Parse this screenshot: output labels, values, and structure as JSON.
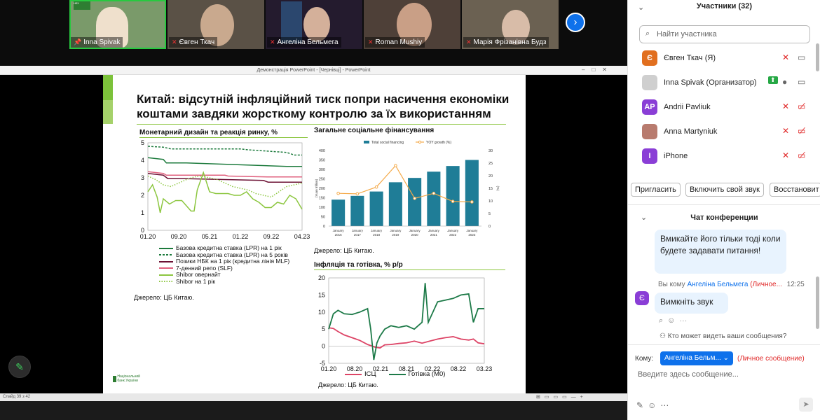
{
  "video_strip": {
    "tiles": [
      {
        "name": "Inna Spivak",
        "mic": "pin",
        "bg": "#7a9a6a"
      },
      {
        "name": "Євген Ткач",
        "mic": "muted",
        "bg": "#5a5146"
      },
      {
        "name": "Ангеліна Бельмега",
        "mic": "muted",
        "bg": "#241b2e"
      },
      {
        "name": "Roman Mushiy",
        "mic": "muted",
        "bg": "#4e4038"
      },
      {
        "name": "Марія Фрізанівна Будз",
        "mic": "muted",
        "bg": "#6b6152"
      }
    ],
    "next_glyph": "›"
  },
  "ppt": {
    "window_title": "Демонстрація PowerPoint - [Чернівці] - PowerPoint",
    "status_text": "Слайд 39 з 42"
  },
  "slide": {
    "title": "Китай: відсутній інфляційний тиск попри насичення економіки коштами завдяки жорсткому контролю за їх використанням",
    "nbu_logo": "Національний банк України",
    "chart1": {
      "title": "Монетарний дизайн та реакція ринку, %",
      "source": "Джерело: ЦБ Китаю."
    },
    "chart2": {
      "title": "Загальне соціальне фінансування",
      "source": "Джерело: ЦБ Китаю."
    },
    "chart3": {
      "title": "Інфляція та готівка, % р/р",
      "source": "Джерело: ЦБ Китаю."
    }
  },
  "chart_data": [
    {
      "type": "line",
      "title": "Монетарний дизайн та реакція ринку, %",
      "xlabels": [
        "01.20",
        "09.20",
        "05.21",
        "01.22",
        "09.22",
        "04.23"
      ],
      "ylim": [
        0,
        5
      ],
      "yticks": [
        0,
        1,
        2,
        3,
        4,
        5
      ],
      "series": [
        {
          "name": "Базова кредитна ставка (LPR) на 1 рік",
          "color": "#1c7a3c",
          "style": "solid",
          "x": [
            0,
            0.1,
            0.12,
            0.22,
            0.25,
            0.9,
            0.95,
            1
          ],
          "values": [
            4.15,
            4.05,
            3.85,
            3.85,
            3.85,
            3.65,
            3.65,
            3.65
          ]
        },
        {
          "name": "Базова кредитна ставка (LPR) на 5 років",
          "color": "#1c7a3c",
          "style": "dashed",
          "x": [
            0,
            0.1,
            0.15,
            0.6,
            0.65,
            0.9,
            0.95,
            1
          ],
          "values": [
            4.8,
            4.75,
            4.65,
            4.65,
            4.6,
            4.45,
            4.3,
            4.3
          ]
        },
        {
          "name": "Позики НБК на 1 рік (кредитна лінія MLF)",
          "color": "#6b1033",
          "style": "solid",
          "x": [
            0,
            0.1,
            0.13,
            0.22,
            0.25,
            0.75,
            0.78,
            0.85,
            1
          ],
          "values": [
            3.25,
            3.15,
            2.95,
            2.95,
            2.95,
            2.85,
            2.75,
            2.75,
            2.75
          ]
        },
        {
          "name": "7-денний репо (SLF)",
          "color": "#e0607e",
          "style": "solid",
          "x": [
            0,
            0.1,
            0.12,
            0.5,
            0.52,
            0.78,
            1
          ],
          "values": [
            3.35,
            3.25,
            3.15,
            3.15,
            3.1,
            3.05,
            3.05
          ]
        },
        {
          "name": "Shibor овернайт",
          "color": "#8cc63f",
          "style": "solid",
          "x": [
            0,
            0.03,
            0.06,
            0.08,
            0.1,
            0.14,
            0.18,
            0.22,
            0.28,
            0.3,
            0.32,
            0.36,
            0.4,
            0.44,
            0.48,
            0.52,
            0.56,
            0.6,
            0.64,
            0.68,
            0.72,
            0.76,
            0.8,
            0.84,
            0.88,
            0.92,
            0.96,
            1
          ],
          "values": [
            2.2,
            2.6,
            1.9,
            1.0,
            1.8,
            1.5,
            1.7,
            1.7,
            1.1,
            1.1,
            2.3,
            3.3,
            2.2,
            2.1,
            2.1,
            2.1,
            2.0,
            2.0,
            2.2,
            1.8,
            1.6,
            1.3,
            1.3,
            1.6,
            1.5,
            2.0,
            1.8,
            1.2
          ]
        },
        {
          "name": "Shibor на 1 рік",
          "color": "#8cc63f",
          "style": "dotted",
          "x": [
            0,
            0.05,
            0.1,
            0.15,
            0.2,
            0.25,
            0.3,
            0.35,
            0.4,
            0.45,
            0.5,
            0.55,
            0.6,
            0.65,
            0.7,
            0.75,
            0.8,
            0.85,
            0.9,
            0.95,
            1
          ],
          "values": [
            3.1,
            2.9,
            2.6,
            2.5,
            2.7,
            2.9,
            3.05,
            3.1,
            3.0,
            2.9,
            2.7,
            2.5,
            2.4,
            2.3,
            2.1,
            2.0,
            1.9,
            2.2,
            2.5,
            2.6,
            2.7
          ]
        }
      ]
    },
    {
      "type": "bar",
      "title": "Загальне соціальне фінансування",
      "categories": [
        "January 2016",
        "January 2017",
        "January 2018",
        "January 2019",
        "January 2020",
        "January 2021",
        "January 2022",
        "January 2023"
      ],
      "ylim": [
        0,
        400
      ],
      "yticks": [
        0,
        50,
        100,
        150,
        200,
        250,
        300,
        350,
        400
      ],
      "y2lim": [
        0,
        30
      ],
      "y2ticks": [
        0,
        5,
        10,
        15,
        20,
        25,
        30
      ],
      "ylabel": "(Yuan trillion)",
      "y2label": "(%)",
      "series": [
        {
          "name": "Total social financing",
          "color": "#1f7d97",
          "axis": "left",
          "values": [
            140,
            160,
            183,
            232,
            255,
            288,
            318,
            350
          ]
        },
        {
          "name": "YOY growth (%)",
          "color": "#f4a948",
          "axis": "right",
          "values": [
            13,
            12.8,
            15.5,
            24,
            11,
            13,
            9.8,
            9.6
          ]
        }
      ]
    },
    {
      "type": "line",
      "title": "Інфляція та готівка, % р/р",
      "xlabels": [
        "01.20",
        "08.20",
        "02.21",
        "08.21",
        "02.22",
        "08.22",
        "03.23"
      ],
      "ylim": [
        -5,
        20
      ],
      "yticks": [
        -5,
        0,
        5,
        10,
        15,
        20
      ],
      "series": [
        {
          "name": "ІСЦ",
          "color": "#dd4466",
          "x": [
            0,
            0.03,
            0.06,
            0.1,
            0.15,
            0.2,
            0.25,
            0.3,
            0.33,
            0.36,
            0.4,
            0.45,
            0.5,
            0.55,
            0.6,
            0.65,
            0.7,
            0.75,
            0.8,
            0.85,
            0.9,
            0.93,
            0.96,
            1
          ],
          "values": [
            5.4,
            5.2,
            4.3,
            3.3,
            2.5,
            1.7,
            0.5,
            -0.3,
            -0.5,
            0.4,
            0.5,
            0.8,
            1.0,
            1.5,
            0.9,
            1.5,
            2.1,
            2.5,
            2.8,
            2.1,
            1.8,
            2.1,
            1.0,
            0.7
          ]
        },
        {
          "name": "Готівка (М0)",
          "color": "#1d7a48",
          "x": [
            0,
            0.03,
            0.06,
            0.1,
            0.15,
            0.2,
            0.25,
            0.27,
            0.29,
            0.31,
            0.33,
            0.36,
            0.4,
            0.45,
            0.5,
            0.55,
            0.6,
            0.62,
            0.64,
            0.66,
            0.7,
            0.75,
            0.8,
            0.85,
            0.9,
            0.93,
            0.96,
            1
          ],
          "values": [
            5,
            9.5,
            10.5,
            9.5,
            9.3,
            10,
            11,
            5,
            -4,
            1,
            3,
            5,
            6,
            5.5,
            6,
            5,
            7,
            18.5,
            7,
            9,
            13,
            13.5,
            14,
            15,
            15.3,
            7,
            11,
            11
          ]
        }
      ]
    }
  ],
  "panel": {
    "participants_title": "Участники (32)",
    "search_placeholder": "Найти участника",
    "participants": [
      {
        "initial": "Є",
        "name": "Євген Ткач (Я)",
        "color": "#e16f1f",
        "mic": "muted",
        "video": "on"
      },
      {
        "initial": "",
        "name": "Inna Spivak (Организатор)",
        "color": "#cfcfcf",
        "mic": "on",
        "video": "on"
      },
      {
        "initial": "AP",
        "name": "Andrii Pavliuk",
        "color": "#8a3ed6",
        "mic": "muted",
        "video": "off"
      },
      {
        "initial": "",
        "name": "Anna Martyniuk",
        "color": "#b87b6e",
        "mic": "muted",
        "video": "off"
      },
      {
        "initial": "I",
        "name": "iPhone",
        "color": "#8a3ed6",
        "mic": "muted",
        "video": "off"
      }
    ],
    "buttons": [
      "Пригласить",
      "Включить свой звук",
      "Восстановит"
    ],
    "chat_title": "Чат конференции",
    "messages": [
      {
        "text": "Вмикайте його тільки тоді коли будете задавати питання!"
      },
      {
        "from": "Вы кому",
        "to": "Ангеліна Бельмега",
        "tag": "(Личное...",
        "time": "12:25",
        "avatar": "Є",
        "text": "Вимкніть звук"
      }
    ],
    "who_sees": "Кто может видеть ваши сообщения?",
    "to_label": "Кому:",
    "recipient": "Ангеліна Бельм...",
    "private_label": "(Личное сообщение)",
    "input_placeholder": "Введите здесь сообщение..."
  }
}
